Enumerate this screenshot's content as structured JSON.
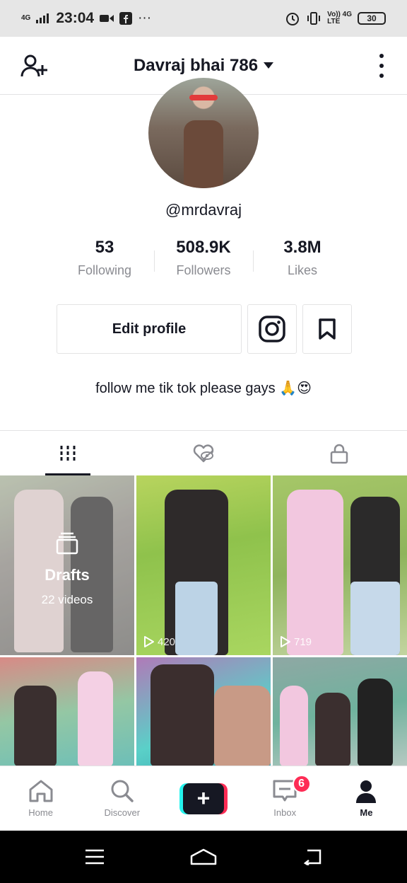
{
  "status_bar": {
    "signal_label": "4G",
    "time": "23:04",
    "dots": "···",
    "network_label": "Vo)) 4G\nLTE",
    "battery": "30"
  },
  "header": {
    "username_title": "Davraj bhai 786"
  },
  "profile": {
    "handle": "@mrdavraj",
    "stats": [
      {
        "value": "53",
        "label": "Following"
      },
      {
        "value": "508.9K",
        "label": "Followers"
      },
      {
        "value": "3.8M",
        "label": "Likes"
      }
    ],
    "edit_label": "Edit profile",
    "bio": "follow me tik tok please gays 🙏😍"
  },
  "tabs": [
    {
      "icon": "videos-grid-icon",
      "active": true
    },
    {
      "icon": "liked-hidden-icon",
      "active": false
    },
    {
      "icon": "lock-icon",
      "active": false
    }
  ],
  "grid": {
    "drafts_title": "Drafts",
    "drafts_count": "22 videos",
    "videos": [
      {
        "views": "420"
      },
      {
        "views": "719"
      }
    ]
  },
  "bottom_nav": {
    "home": "Home",
    "discover": "Discover",
    "create": "+",
    "inbox": "Inbox",
    "inbox_badge": "6",
    "me": "Me"
  },
  "colors": {
    "accent_red": "#fe2c55",
    "accent_cyan": "#25f4ee",
    "text_dark": "#161823",
    "text_muted": "#8a8b91"
  }
}
